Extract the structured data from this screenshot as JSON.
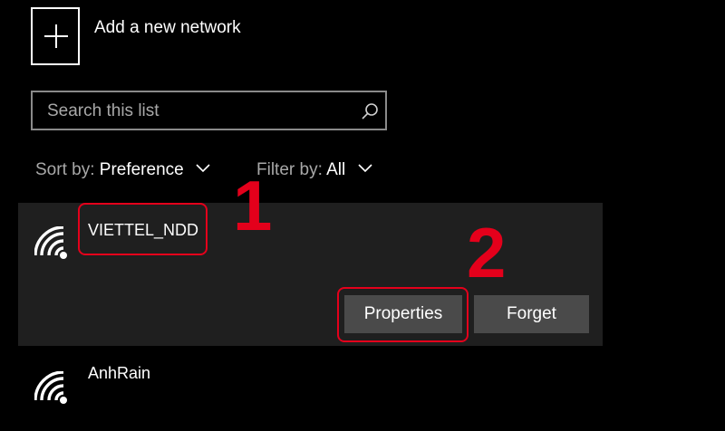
{
  "add_network": {
    "label": "Add a new network"
  },
  "search": {
    "placeholder": "Search this list"
  },
  "sort": {
    "label": "Sort by:",
    "value": "Preference"
  },
  "filter": {
    "label": "Filter by:",
    "value": "All"
  },
  "networks": [
    {
      "name": "VIETTEL_NDD",
      "selected": true
    },
    {
      "name": "AnhRain",
      "selected": false
    }
  ],
  "actions": {
    "properties_label": "Properties",
    "forget_label": "Forget"
  },
  "annotations": {
    "step1": "1",
    "step2": "2"
  },
  "colors": {
    "highlight": "#e4001b",
    "panel": "#1f1f1f",
    "button": "#4a4a4a"
  }
}
